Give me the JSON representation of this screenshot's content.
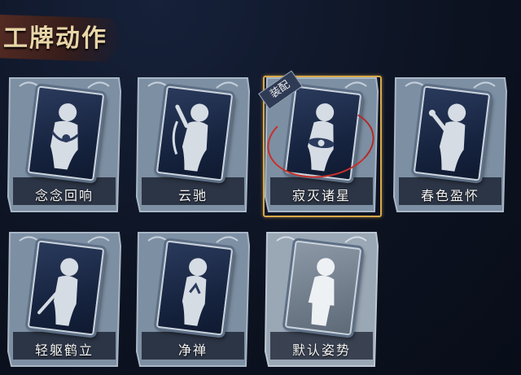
{
  "title": "工牌动作",
  "equipped_badge": "装配",
  "cards": [
    {
      "label": "念念回响",
      "state": "normal",
      "pose": "hug"
    },
    {
      "label": "云驰",
      "state": "normal",
      "pose": "reach"
    },
    {
      "label": "寂灭诸星",
      "state": "equipped",
      "pose": "stars"
    },
    {
      "label": "春色盈怀",
      "state": "normal",
      "pose": "flower"
    },
    {
      "label": "轻躯鹤立",
      "state": "normal",
      "pose": "crane"
    },
    {
      "label": "净禅",
      "state": "normal",
      "pose": "zen"
    },
    {
      "label": "默认姿势",
      "state": "default",
      "pose": "stand"
    }
  ],
  "colors": {
    "background": "#0c1220",
    "title": "#e9d6a8",
    "frame": "#8395a9",
    "equipped_border": "#d8a94a",
    "equipped_ring": "#c8302a"
  }
}
